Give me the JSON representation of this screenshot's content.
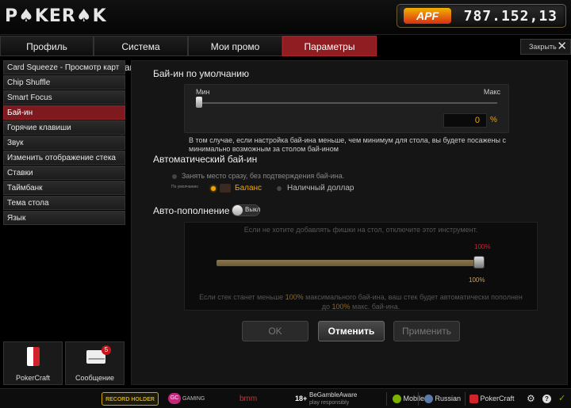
{
  "header": {
    "logo_text": "P♠KER♠K",
    "badge_text": "APF",
    "balance": "787.152,13"
  },
  "tabs": [
    {
      "label": "Профиль"
    },
    {
      "label": "Система вознаграждений"
    },
    {
      "label": "Мои промо"
    },
    {
      "label": "Параметры"
    }
  ],
  "close_label": "Закрыть",
  "sidebar": {
    "items": [
      {
        "label": "Card Squeeze - Просмотр карт"
      },
      {
        "label": "Chip Shuffle"
      },
      {
        "label": "Smart Focus"
      },
      {
        "label": "Бай-ин"
      },
      {
        "label": "Горячие клавиши"
      },
      {
        "label": "Звук"
      },
      {
        "label": "Изменить отображение стека"
      },
      {
        "label": "Ставки"
      },
      {
        "label": "Таймбанк"
      },
      {
        "label": "Тема стола"
      },
      {
        "label": "Язык"
      }
    ],
    "active_index": 3,
    "bottom": {
      "pokercraft_label": "PokerCraft",
      "message_label": "Сообщение",
      "message_count": "5"
    }
  },
  "buyin": {
    "title": "Бай-ин по умолчанию",
    "min_label": "Мин",
    "max_label": "Макс",
    "slider_fraction": 0,
    "value": "0",
    "percent_sign": "%",
    "note": "В том случае, если настройка бай-ина меньше, чем минимум для стола, вы будете посажены с минимально возможным за столом бай-ином"
  },
  "auto_buyin": {
    "title": "Автоматический бай-ин",
    "option_instant": "Занять место сразу, без подтверждения бай-ина.",
    "default_caption": "По умолчанию",
    "option_balance": "Баланс",
    "option_cash": "Наличный доллар"
  },
  "auto_refill": {
    "title": "Авто-пополнение",
    "toggle_label": "Выкл",
    "hint": "Если не хотите добавлять фишки на стол, отключите этот инструмент.",
    "top_percent": "100%",
    "bottom_percent": "100%",
    "msg_part1": "Если стек станет меньше ",
    "msg_hl1": "100%",
    "msg_part2": " максимального бай-ина, ваш стек будет автоматически пополнен",
    "msg_part3": "до ",
    "msg_hl2": "100%",
    "msg_part4": " макс. бай-ина."
  },
  "buttons": {
    "ok": "OK",
    "cancel": "Отменить",
    "apply": "Применить"
  },
  "footer": {
    "record_holder": "RECORD HOLDER",
    "gc_text": "GAMING CURACAO",
    "bmm_text": "bmm testlabs",
    "age_text": "18+",
    "bga_main": "BeGambleAware",
    "bga_sub": "play responsibly",
    "mobile": "Mobile",
    "language": "Russian",
    "pokercraft": "PokerCraft"
  },
  "colors": {
    "accent_red": "#8f1d22",
    "accent_orange": "#f1a400"
  }
}
